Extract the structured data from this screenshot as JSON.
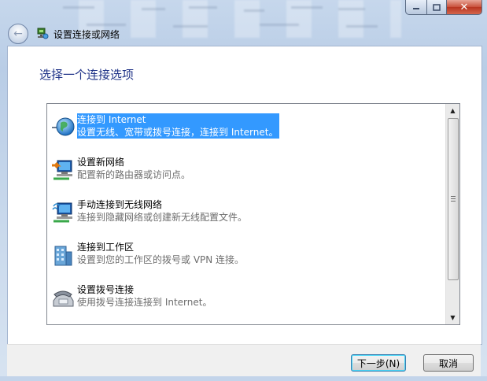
{
  "window": {
    "title": "设置连接或网络",
    "minimize_label": "",
    "maximize_label": "",
    "close_label": "✕"
  },
  "page": {
    "heading": "选择一个连接选项"
  },
  "options": [
    {
      "title": "连接到 Internet",
      "desc": "设置无线、宽带或拨号连接，连接到 Internet。",
      "icon": "globe-network-icon",
      "selected": true
    },
    {
      "title": "设置新网络",
      "desc": "配置新的路由器或访问点。",
      "icon": "router-setup-icon",
      "selected": false
    },
    {
      "title": "手动连接到无线网络",
      "desc": "连接到隐藏网络或创建新无线配置文件。",
      "icon": "wireless-computer-icon",
      "selected": false
    },
    {
      "title": "连接到工作区",
      "desc": "设置到您的工作区的拨号或 VPN 连接。",
      "icon": "workplace-building-icon",
      "selected": false
    },
    {
      "title": "设置拨号连接",
      "desc": "使用拨号连接连接到 Internet。",
      "icon": "dialup-phone-icon",
      "selected": false
    }
  ],
  "buttons": {
    "next": "下一步(N)",
    "cancel": "取消"
  },
  "colors": {
    "selection": "#3399ff",
    "heading": "#1e3287"
  }
}
